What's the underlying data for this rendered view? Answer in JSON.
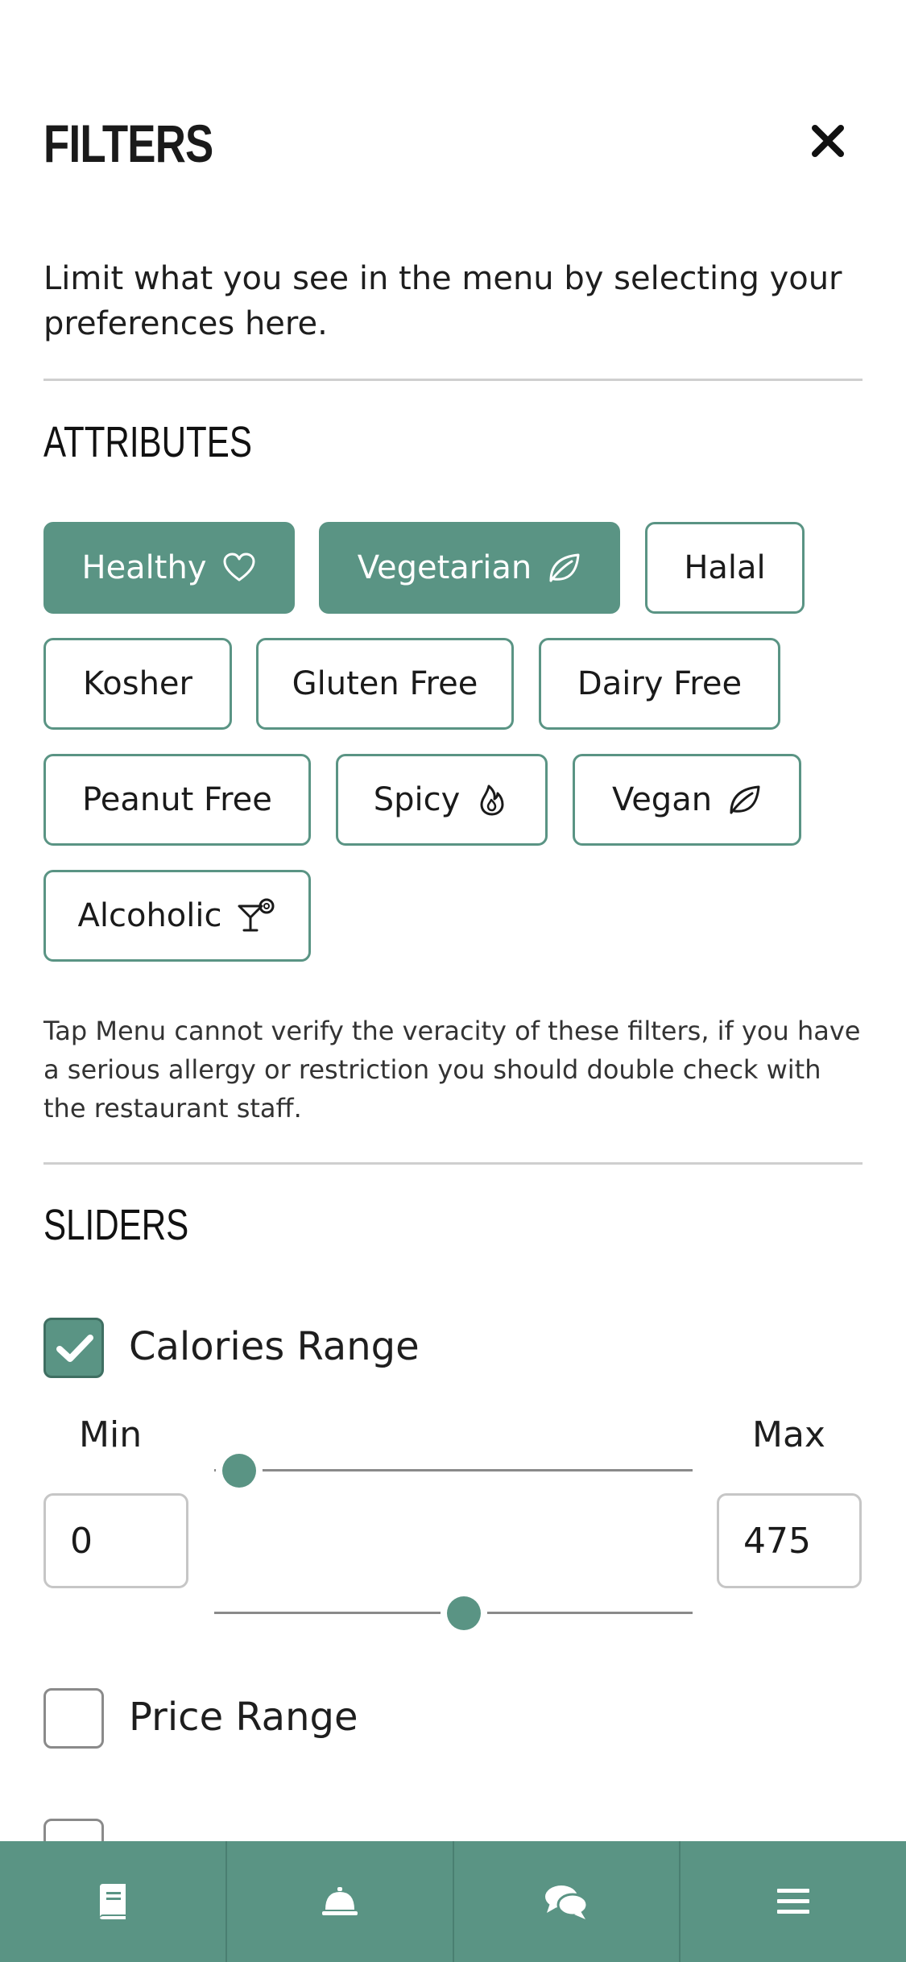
{
  "header": {
    "title": "FILTERS",
    "close_icon": "close-icon"
  },
  "intro": "Limit what you see in the menu by selecting your preferences here.",
  "attributes": {
    "title": "ATTRIBUTES",
    "chips": [
      {
        "label": "Healthy",
        "icon": "heart-icon",
        "active": true
      },
      {
        "label": "Vegetarian",
        "icon": "leaf-icon",
        "active": true
      },
      {
        "label": "Halal",
        "icon": "",
        "active": false
      },
      {
        "label": "Kosher",
        "icon": "",
        "active": false
      },
      {
        "label": "Gluten Free",
        "icon": "",
        "active": false
      },
      {
        "label": "Dairy Free",
        "icon": "",
        "active": false
      },
      {
        "label": "Peanut Free",
        "icon": "",
        "active": false
      },
      {
        "label": "Spicy",
        "icon": "flame-icon",
        "active": false
      },
      {
        "label": "Vegan",
        "icon": "leaf-icon",
        "active": false
      },
      {
        "label": "Alcoholic",
        "icon": "cocktail-icon",
        "active": false
      }
    ],
    "disclaimer": "Tap Menu cannot verify the veracity of these filters, if you have a serious allergy or restriction you should double check with the restaurant staff."
  },
  "sliders": {
    "title": "SLIDERS",
    "calories": {
      "label": "Calories Range",
      "checked": true,
      "min_label": "Min",
      "max_label": "Max",
      "min_value": "0",
      "max_value": "475"
    },
    "price": {
      "label": "Price Range",
      "checked": false
    }
  },
  "tabbar": {
    "tabs": [
      {
        "name": "menu",
        "icon": "book-icon"
      },
      {
        "name": "service",
        "icon": "service-bell-icon"
      },
      {
        "name": "chat",
        "icon": "chat-bubbles-icon"
      },
      {
        "name": "more",
        "icon": "hamburger-menu-icon"
      }
    ]
  },
  "colors": {
    "accent": "#5a9484",
    "divider": "#cfcfcf"
  }
}
